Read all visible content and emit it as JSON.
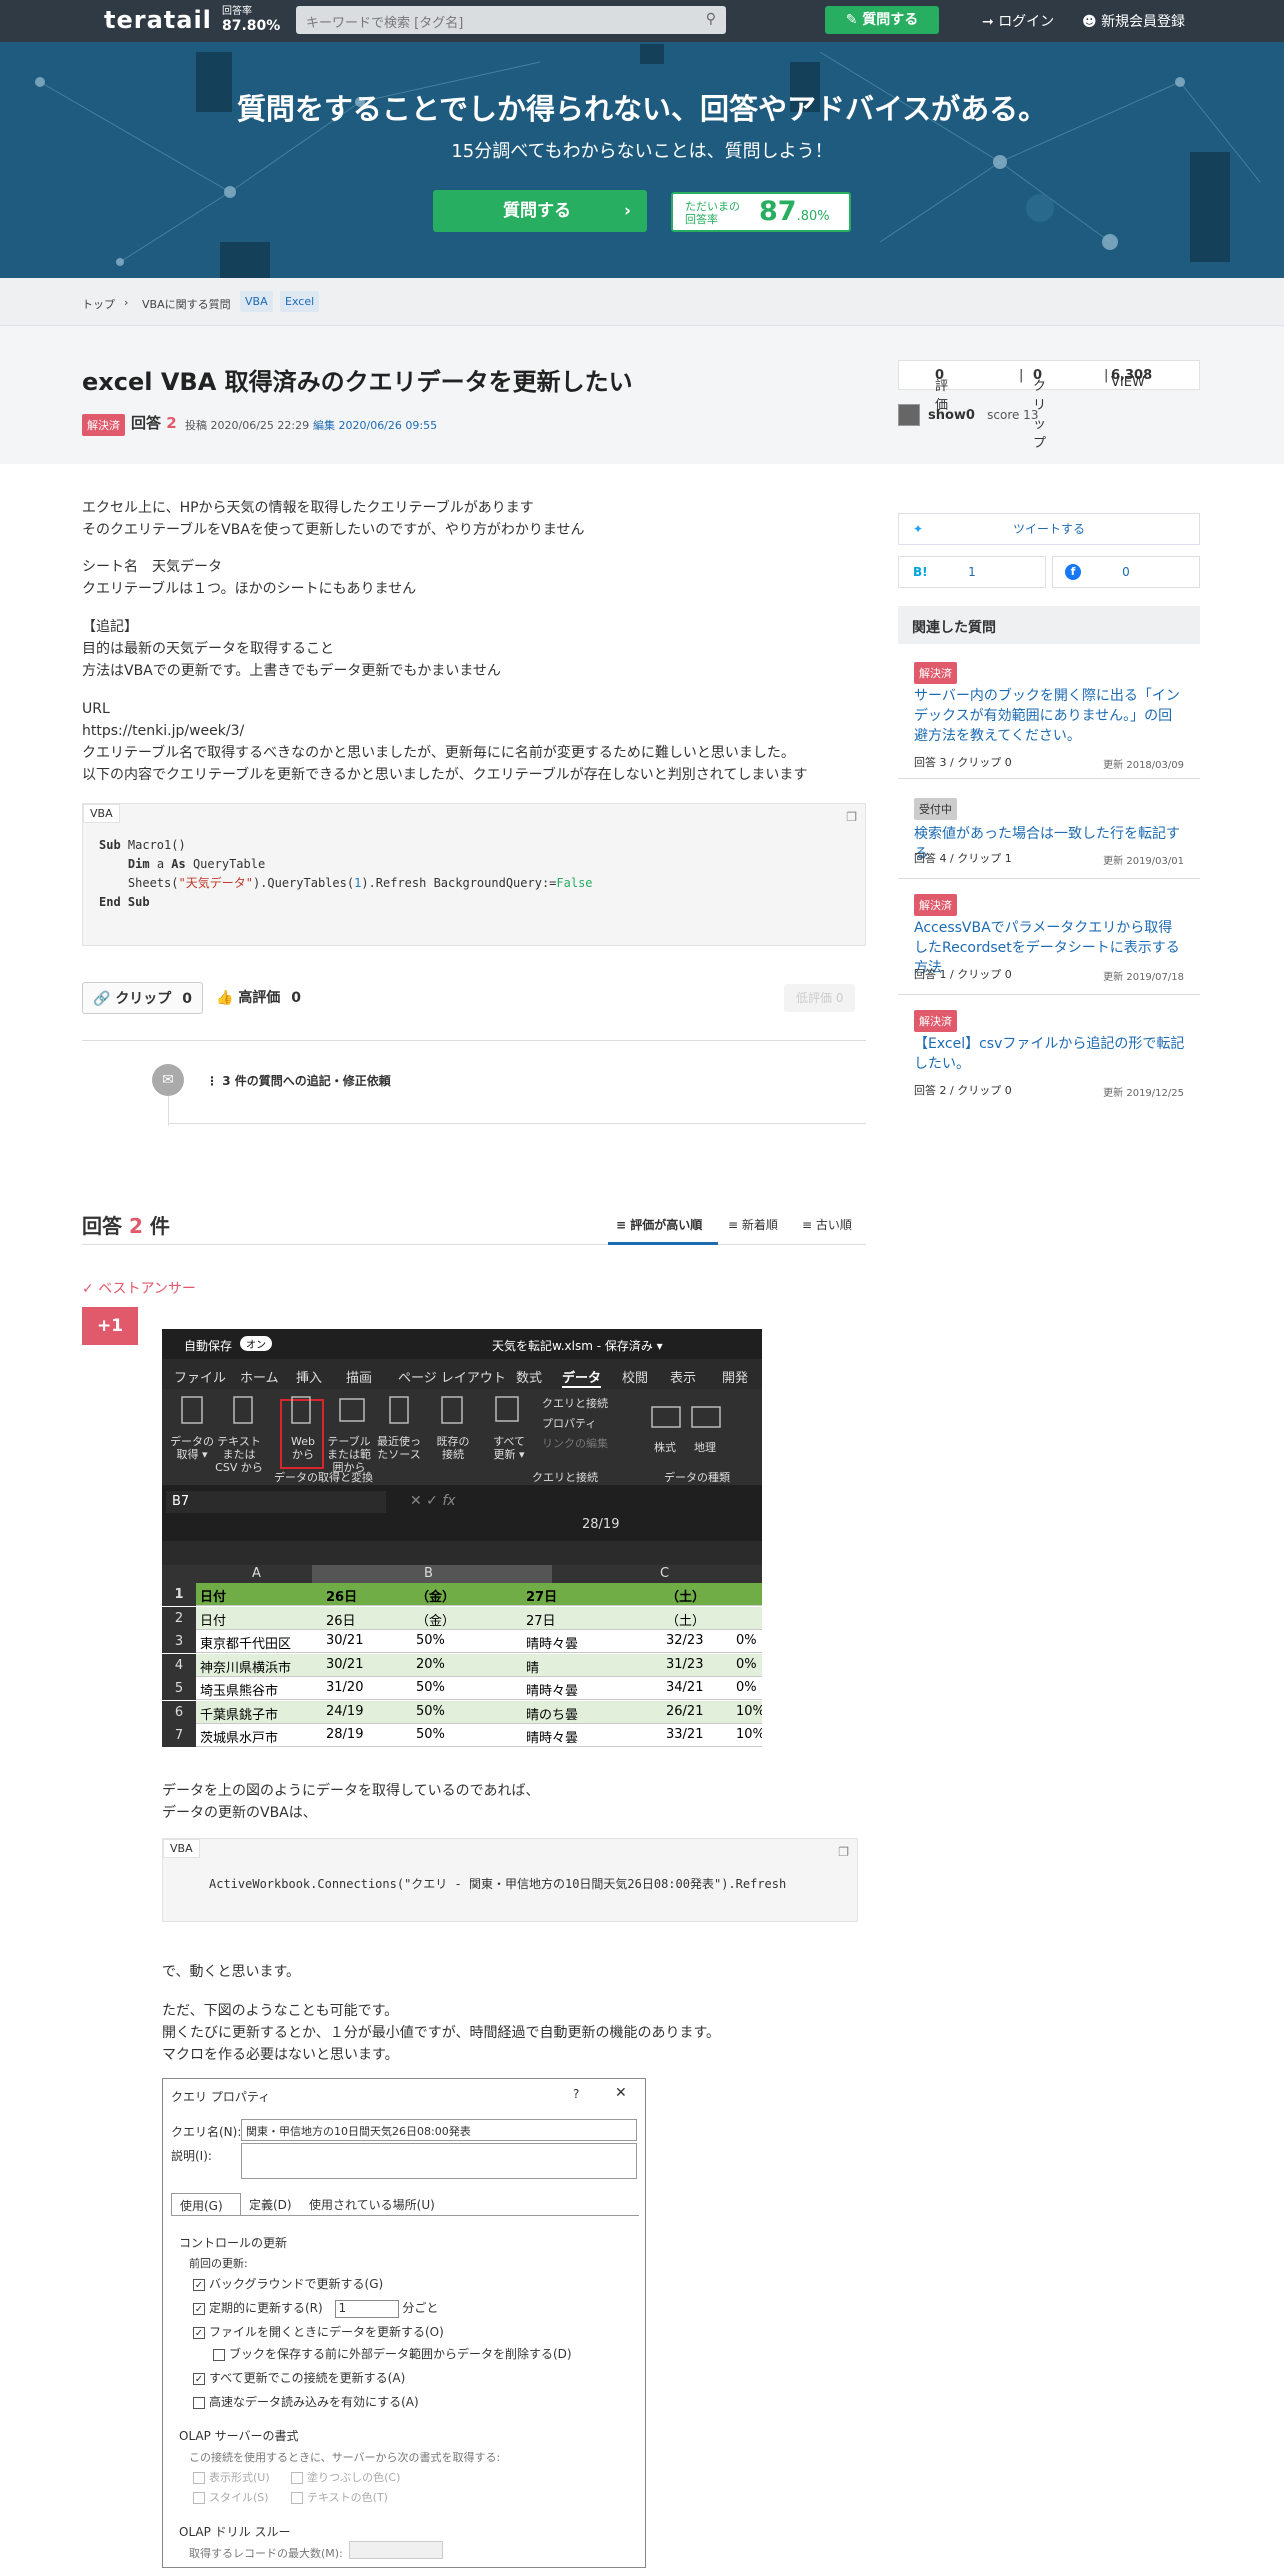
{
  "header": {
    "logo": "teratail",
    "rate_label": "回答率",
    "rate_value": "87.80%",
    "search_placeholder": "キーワードで検索 [タグ名]",
    "ask_button": "質問する",
    "login": "ログイン",
    "signup": "新規会員登録"
  },
  "hero": {
    "title": "質問をすることでしか得られない、回答やアドバイスがある。",
    "subtitle": "15分調べてもわからないことは、質問しよう！",
    "ask_button": "質問する",
    "rate_label1": "ただいまの",
    "rate_label2": "回答率",
    "rate_big": "87",
    "rate_small": ".80%"
  },
  "breadcrumb": {
    "top": "トップ",
    "sep": "›",
    "cat": "VBAに関する質問",
    "tags": [
      "VBA",
      "Excel"
    ]
  },
  "question": {
    "title": "excel VBA 取得済みのクエリデータを更新したい",
    "status": "解決済",
    "answers_label": "回答",
    "answers_count": "2",
    "posted": "投稿 2020/06/25 22:29",
    "edited": "· 編集 2020/06/26 09:55",
    "eval_label": "評価",
    "eval": "0",
    "clip_label": "クリップ",
    "clip": "0",
    "view_label": "VIEW",
    "view": "6,308",
    "user": "show0",
    "score": "score 13",
    "body": [
      "エクセル上に、HPから天気の情報を取得したクエリテーブルがあります",
      "そのクエリテーブルをVBAを使って更新したいのですが、やり方がわかりません",
      "シート名　天気データ",
      "クエリテーブルは１つ。ほかのシートにもありません",
      "【追記】",
      "目的は最新の天気データを取得すること",
      "方法はVBAでの更新です。上書きでもデータ更新でもかまいません",
      "URL",
      "https://tenki.jp/week/3/",
      "クエリテーブル名で取得するべきなのかと思いましたが、更新毎にに名前が変更するために難しいと思いました。",
      "以下の内容でクエリテーブルを更新できるかと思いましたが、クエリテーブルが存在しないと判別されてしまいます"
    ],
    "code_lang": "VBA",
    "clip_btn": "クリップ",
    "clip_btn_count": "0",
    "good_btn": "高評価",
    "good_btn_count": "0",
    "bad_btn": "低評価",
    "bad_btn_count": "0",
    "comment": "3 件の質問への追記・修正依頼"
  },
  "sidebar": {
    "tweet": "ツイートする",
    "hatena_count": "1",
    "fb_count": "0",
    "related_title": "関連した質問",
    "related": [
      {
        "status": "解決済",
        "title": "サーバー内のブックを開く際に出る「インデックスが有効範囲にありません。」の回避方法を教えてください。",
        "meta": "回答 3 / クリップ 0",
        "date": "更新 2018/03/09"
      },
      {
        "status": "受付中",
        "title": "検索値があった場合は一致した行を転記する",
        "meta": "回答 4 / クリップ 1",
        "date": "更新 2019/03/01"
      },
      {
        "status": "解決済",
        "title": "AccessVBAでパラメータクエリから取得したRecordsetをデータシートに表示する方法",
        "meta": "回答 1 / クリップ 0",
        "date": "更新 2019/07/18"
      },
      {
        "status": "解決済",
        "title": "【Excel】csvファイルから追記の形で転記したい。",
        "meta": "回答 2 / クリップ 0",
        "date": "更新 2019/12/25"
      }
    ]
  },
  "answers": {
    "title": "回答",
    "count": "2",
    "unit": "件",
    "sort": [
      "評価が高い順",
      "新着順",
      "古い順"
    ],
    "best": "ベストアンサー",
    "plus": "+1",
    "text1": [
      "データを上の図のようにデータを取得しているのであれば、",
      "データの更新のVBAは、"
    ],
    "code_lang": "VBA",
    "code": "ActiveWorkbook.Connections(\"クエリ - 関東・甲信地方の10日間天気26日08:00発表\").Refresh",
    "text2": "で、動くと思います。",
    "text3": [
      "ただ、下図のようなことも可能です。",
      "開くたびに更新するとか、１分が最小値ですが、時間経過で自動更新の機能のあります。",
      "マクロを作る必要はないと思います。"
    ]
  },
  "excel": {
    "autosave": "自動保存",
    "toggle": "オン",
    "filename": "天気を転記w.xlsm - 保存済み ▾",
    "tabs": [
      "ファイル",
      "ホーム",
      "挿入",
      "描画",
      "ページ レイアウト",
      "数式",
      "データ",
      "校閲",
      "表示",
      "開発"
    ],
    "ribbon": [
      "データの取得 ▾",
      "テキストまたは CSV から",
      "Web から",
      "テーブルまたは範囲から",
      "最近使ったソース",
      "既存の接続",
      "すべて更新 ▾"
    ],
    "ribbon_small": [
      "クエリと接続",
      "プロパティ",
      "リンクの編集"
    ],
    "ribbon_types": [
      "株式",
      "地理"
    ],
    "groups": [
      "データの取得と変換",
      "クエリと接続",
      "データの種類"
    ],
    "namebox": "B7",
    "formula": "28/19",
    "cols": [
      "A",
      "B",
      "C"
    ],
    "rows": [
      [
        "1",
        "日付",
        "26日",
        "（金）",
        "27日",
        "（土）",
        ""
      ],
      [
        "2",
        "日付",
        "26日",
        "（金）",
        "27日",
        "（土）",
        ""
      ],
      [
        "3",
        "東京都千代田区",
        "30/21",
        "50%",
        "晴時々曇",
        "32/23",
        "0%"
      ],
      [
        "4",
        "神奈川県横浜市",
        "30/21",
        "20%",
        "晴",
        "31/23",
        "0%"
      ],
      [
        "5",
        "埼玉県熊谷市",
        "31/20",
        "50%",
        "晴時々曇",
        "34/21",
        "0%"
      ],
      [
        "6",
        "千葉県銚子市",
        "24/19",
        "50%",
        "晴のち曇",
        "26/21",
        "10%"
      ],
      [
        "7",
        "茨城県水戸市",
        "28/19",
        "50%",
        "晴時々曇",
        "33/21",
        "10%"
      ]
    ]
  },
  "dialog": {
    "title": "クエリ プロパティ",
    "name_label": "クエリ名(N):",
    "name_value": "関東・甲信地方の10日間天気26日08:00発表",
    "desc_label": "説明(I):",
    "tabs": [
      "使用(G)",
      "定義(D)",
      "使用されている場所(U)"
    ],
    "section1": "コントロールの更新",
    "last": "前回の更新:",
    "opt1": "バックグラウンドで更新する(G)",
    "opt2": "定期的に更新する(R)",
    "interval": "1",
    "unit": "分ごと",
    "opt3": "ファイルを開くときにデータを更新する(O)",
    "opt4": "ブックを保存する前に外部データ範囲からデータを削除する(D)",
    "opt5": "すべて更新でこの接続を更新する(A)",
    "opt6": "高速なデータ読み込みを有効にする(A)",
    "section2": "OLAP サーバーの書式",
    "olap_desc": "この接続を使用するときに、サーバーから次の書式を取得する:",
    "olap": [
      "表示形式(U)",
      "塗りつぶしの色(C)",
      "スタイル(S)",
      "テキストの色(T)"
    ],
    "section3": "OLAP ドリル スルー",
    "drill": "取得するレコードの最大数(M):"
  },
  "colors": {
    "green": "#27ae60",
    "red": "#e05a6b",
    "blue": "#1d6bb3",
    "navy": "#2f3a44"
  }
}
